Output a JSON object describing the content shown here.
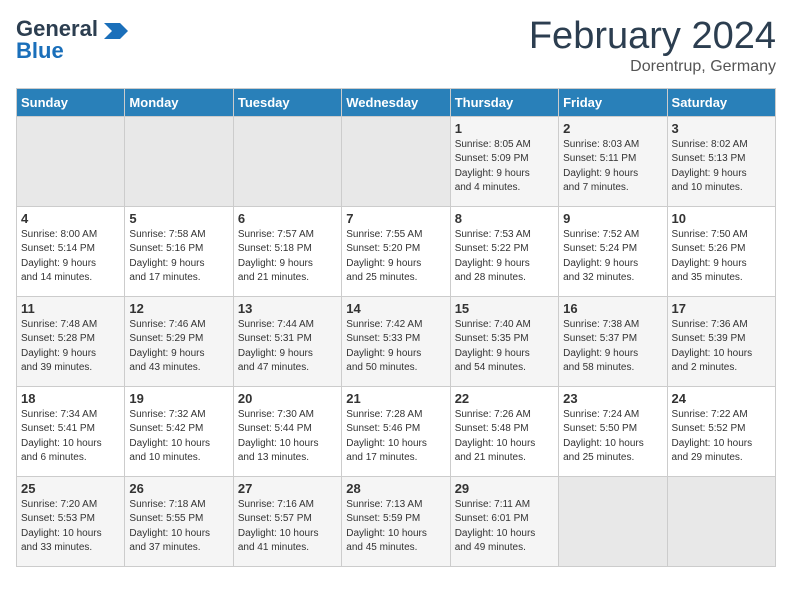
{
  "header": {
    "logo_line1": "General",
    "logo_line2": "Blue",
    "main_title": "February 2024",
    "subtitle": "Dorentrup, Germany"
  },
  "days_of_week": [
    "Sunday",
    "Monday",
    "Tuesday",
    "Wednesday",
    "Thursday",
    "Friday",
    "Saturday"
  ],
  "weeks": [
    [
      {
        "day": "",
        "content": ""
      },
      {
        "day": "",
        "content": ""
      },
      {
        "day": "",
        "content": ""
      },
      {
        "day": "",
        "content": ""
      },
      {
        "day": "1",
        "content": "Sunrise: 8:05 AM\nSunset: 5:09 PM\nDaylight: 9 hours\nand 4 minutes."
      },
      {
        "day": "2",
        "content": "Sunrise: 8:03 AM\nSunset: 5:11 PM\nDaylight: 9 hours\nand 7 minutes."
      },
      {
        "day": "3",
        "content": "Sunrise: 8:02 AM\nSunset: 5:13 PM\nDaylight: 9 hours\nand 10 minutes."
      }
    ],
    [
      {
        "day": "4",
        "content": "Sunrise: 8:00 AM\nSunset: 5:14 PM\nDaylight: 9 hours\nand 14 minutes."
      },
      {
        "day": "5",
        "content": "Sunrise: 7:58 AM\nSunset: 5:16 PM\nDaylight: 9 hours\nand 17 minutes."
      },
      {
        "day": "6",
        "content": "Sunrise: 7:57 AM\nSunset: 5:18 PM\nDaylight: 9 hours\nand 21 minutes."
      },
      {
        "day": "7",
        "content": "Sunrise: 7:55 AM\nSunset: 5:20 PM\nDaylight: 9 hours\nand 25 minutes."
      },
      {
        "day": "8",
        "content": "Sunrise: 7:53 AM\nSunset: 5:22 PM\nDaylight: 9 hours\nand 28 minutes."
      },
      {
        "day": "9",
        "content": "Sunrise: 7:52 AM\nSunset: 5:24 PM\nDaylight: 9 hours\nand 32 minutes."
      },
      {
        "day": "10",
        "content": "Sunrise: 7:50 AM\nSunset: 5:26 PM\nDaylight: 9 hours\nand 35 minutes."
      }
    ],
    [
      {
        "day": "11",
        "content": "Sunrise: 7:48 AM\nSunset: 5:28 PM\nDaylight: 9 hours\nand 39 minutes."
      },
      {
        "day": "12",
        "content": "Sunrise: 7:46 AM\nSunset: 5:29 PM\nDaylight: 9 hours\nand 43 minutes."
      },
      {
        "day": "13",
        "content": "Sunrise: 7:44 AM\nSunset: 5:31 PM\nDaylight: 9 hours\nand 47 minutes."
      },
      {
        "day": "14",
        "content": "Sunrise: 7:42 AM\nSunset: 5:33 PM\nDaylight: 9 hours\nand 50 minutes."
      },
      {
        "day": "15",
        "content": "Sunrise: 7:40 AM\nSunset: 5:35 PM\nDaylight: 9 hours\nand 54 minutes."
      },
      {
        "day": "16",
        "content": "Sunrise: 7:38 AM\nSunset: 5:37 PM\nDaylight: 9 hours\nand 58 minutes."
      },
      {
        "day": "17",
        "content": "Sunrise: 7:36 AM\nSunset: 5:39 PM\nDaylight: 10 hours\nand 2 minutes."
      }
    ],
    [
      {
        "day": "18",
        "content": "Sunrise: 7:34 AM\nSunset: 5:41 PM\nDaylight: 10 hours\nand 6 minutes."
      },
      {
        "day": "19",
        "content": "Sunrise: 7:32 AM\nSunset: 5:42 PM\nDaylight: 10 hours\nand 10 minutes."
      },
      {
        "day": "20",
        "content": "Sunrise: 7:30 AM\nSunset: 5:44 PM\nDaylight: 10 hours\nand 13 minutes."
      },
      {
        "day": "21",
        "content": "Sunrise: 7:28 AM\nSunset: 5:46 PM\nDaylight: 10 hours\nand 17 minutes."
      },
      {
        "day": "22",
        "content": "Sunrise: 7:26 AM\nSunset: 5:48 PM\nDaylight: 10 hours\nand 21 minutes."
      },
      {
        "day": "23",
        "content": "Sunrise: 7:24 AM\nSunset: 5:50 PM\nDaylight: 10 hours\nand 25 minutes."
      },
      {
        "day": "24",
        "content": "Sunrise: 7:22 AM\nSunset: 5:52 PM\nDaylight: 10 hours\nand 29 minutes."
      }
    ],
    [
      {
        "day": "25",
        "content": "Sunrise: 7:20 AM\nSunset: 5:53 PM\nDaylight: 10 hours\nand 33 minutes."
      },
      {
        "day": "26",
        "content": "Sunrise: 7:18 AM\nSunset: 5:55 PM\nDaylight: 10 hours\nand 37 minutes."
      },
      {
        "day": "27",
        "content": "Sunrise: 7:16 AM\nSunset: 5:57 PM\nDaylight: 10 hours\nand 41 minutes."
      },
      {
        "day": "28",
        "content": "Sunrise: 7:13 AM\nSunset: 5:59 PM\nDaylight: 10 hours\nand 45 minutes."
      },
      {
        "day": "29",
        "content": "Sunrise: 7:11 AM\nSunset: 6:01 PM\nDaylight: 10 hours\nand 49 minutes."
      },
      {
        "day": "",
        "content": ""
      },
      {
        "day": "",
        "content": ""
      }
    ]
  ]
}
